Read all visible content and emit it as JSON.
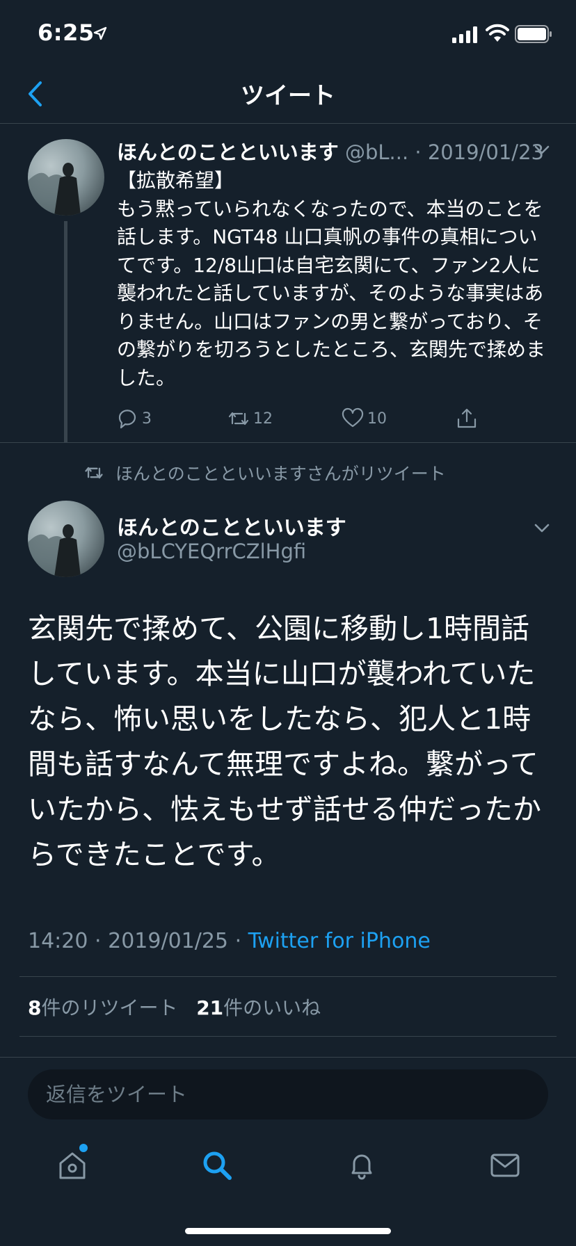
{
  "status_bar": {
    "time": "6:25"
  },
  "header": {
    "title": "ツイート"
  },
  "thread_tweet": {
    "name": "ほんとのことといいます",
    "handle": "@bL...",
    "separator": "·",
    "date": "2019/01/23",
    "text": "【拡散希望】\nもう黙っていられなくなったので、本当のことを話します。NGT48 山口真帆の事件の真相についてです。12/8山口は自宅玄関にて、ファン2人に襲われたと話していますが、そのような事実はありません。山口はファンの男と繋がっており、その繋がりを切ろうとしたところ、玄関先で揉めました。",
    "reply_count": "3",
    "retweet_count": "12",
    "like_count": "10"
  },
  "retweet_context": {
    "text": "ほんとのことといいますさんがリツイート"
  },
  "main_tweet": {
    "name": "ほんとのことといいます",
    "handle": "@bLCYEQrrCZlHgfi",
    "text": "玄関先で揉めて、公園に移動し1時間話しています。本当に山口が襲われていたなら、怖い思いをしたなら、犯人と1時間も話すなんて無理ですよね。繋がっていたから、怯えもせず話せる仲だったからできたことです。",
    "time": "14:20",
    "date": "2019/01/25",
    "separator": "·",
    "source": "Twitter for iPhone",
    "retweets_count": "8",
    "retweets_label": "件のリツイート",
    "likes_count": "21",
    "likes_label": "件のいいね"
  },
  "composer": {
    "placeholder": "返信をツイート"
  },
  "tab_bar": {
    "items": [
      "home-icon",
      "search-icon",
      "bell-icon",
      "mail-icon"
    ],
    "active": "search-icon"
  },
  "colors": {
    "background": "#15202b",
    "accent": "#1da1f2",
    "muted": "#8899a6",
    "divider": "#38444d"
  }
}
